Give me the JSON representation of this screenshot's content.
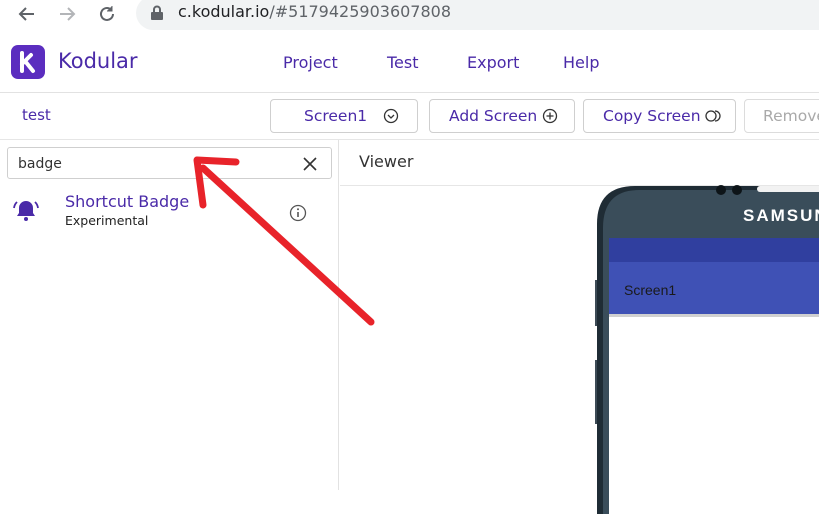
{
  "browser": {
    "url_host": "c.kodular.io",
    "url_rest": "/#5179425903607808"
  },
  "app": {
    "brand": "Kodular",
    "menu": [
      "Project",
      "Test",
      "Export",
      "Help"
    ]
  },
  "toolbar": {
    "project_name": "test",
    "screen_select_label": "Screen1",
    "add_screen_label": "Add Screen",
    "copy_screen_label": "Copy Screen",
    "remove_label": "Remove"
  },
  "palette": {
    "search_value": "badge",
    "search_placeholder": "",
    "items": [
      {
        "title": "Shortcut Badge",
        "subtitle": "Experimental"
      }
    ]
  },
  "viewer": {
    "title": "Viewer",
    "phone_brand": "SAMSUNG",
    "screen_title": "Screen1"
  },
  "colors": {
    "brand_purple": "#4a2aa8",
    "appbar_blue": "#3f51b5",
    "statusbar_blue": "#303f9f",
    "annotation_red": "#e8232a"
  }
}
